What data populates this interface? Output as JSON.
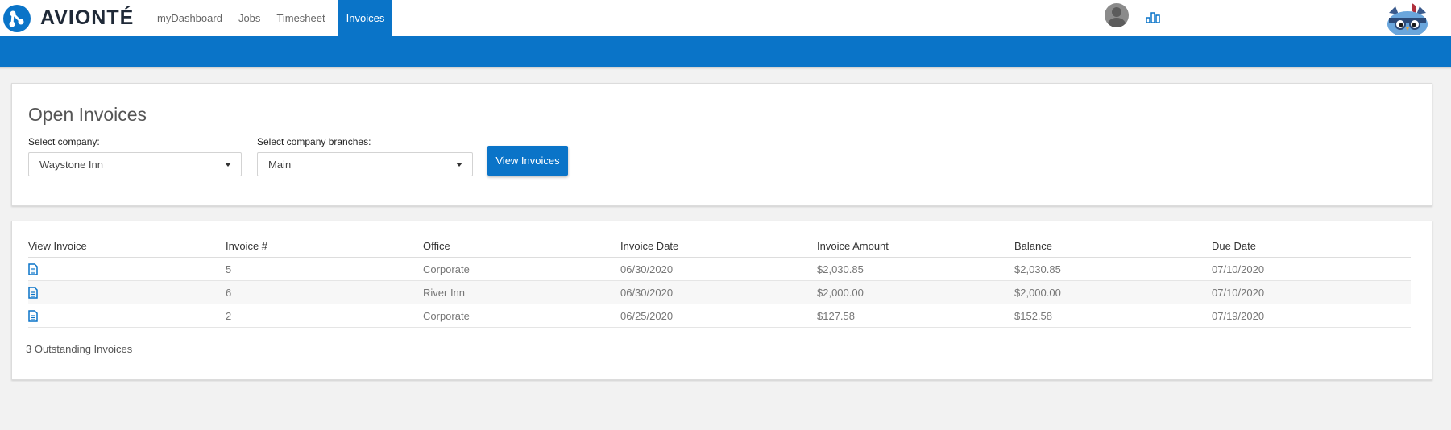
{
  "app": {
    "brand": "AVIONTÉ"
  },
  "nav": {
    "items": [
      {
        "label": "myDashboard",
        "active": false
      },
      {
        "label": "Jobs",
        "active": false
      },
      {
        "label": "Timesheet",
        "active": false
      },
      {
        "label": "Invoices",
        "active": true
      }
    ]
  },
  "header_icons": {
    "avatar": "user-avatar-icon",
    "reports": "bar-chart-icon",
    "mascot": "owl-mascot-icon"
  },
  "filters": {
    "title": "Open Invoices",
    "company_label": "Select company:",
    "company_value": "Waystone Inn",
    "branches_label": "Select company branches:",
    "branches_value": "Main",
    "view_button": "View Invoices"
  },
  "table": {
    "headers": [
      "View Invoice",
      "Invoice #",
      "Office",
      "Invoice Date",
      "Invoice Amount",
      "Balance",
      "Due Date"
    ],
    "rows": [
      {
        "invoice": "5",
        "office": "Corporate",
        "date": "06/30/2020",
        "amount": "$2,030.85",
        "balance": "$2,030.85",
        "due": "07/10/2020"
      },
      {
        "invoice": "6",
        "office": "River Inn",
        "date": "06/30/2020",
        "amount": "$2,000.00",
        "balance": "$2,000.00",
        "due": "07/10/2020"
      },
      {
        "invoice": "2",
        "office": "Corporate",
        "date": "06/25/2020",
        "amount": "$127.58",
        "balance": "$152.58",
        "due": "07/19/2020"
      }
    ],
    "footer": "3 Outstanding Invoices"
  },
  "colors": {
    "brand_blue": "#0a74c8",
    "background": "#f2f2f2"
  }
}
